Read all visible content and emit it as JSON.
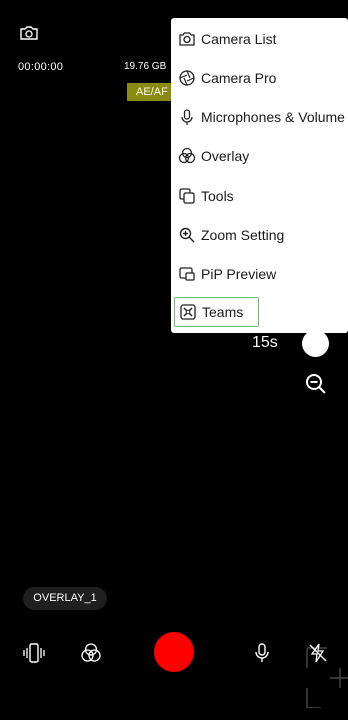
{
  "status": {
    "timer": "00:00:00",
    "storage": "19.76 GB",
    "ae_af": "AE/AF"
  },
  "menu": {
    "items": [
      {
        "label": "Camera List",
        "icon": "camera-icon"
      },
      {
        "label": "Camera Pro",
        "icon": "aperture-icon"
      },
      {
        "label": "Microphones & Volume",
        "icon": "microphone-icon"
      },
      {
        "label": "Overlay",
        "icon": "overlay-icon"
      },
      {
        "label": "Tools",
        "icon": "tools-icon"
      },
      {
        "label": "Zoom Setting",
        "icon": "zoom-in-icon"
      },
      {
        "label": "PiP Preview",
        "icon": "pip-icon"
      },
      {
        "label": "Teams",
        "icon": "teams-icon",
        "selected": true
      }
    ]
  },
  "controls": {
    "duration": "15s",
    "overlay_chip": "OVERLAY_1"
  },
  "colors": {
    "record": "#ff0000",
    "ae_af_bg": "#8a8a0f",
    "selected_border": "#6fbf7a"
  }
}
